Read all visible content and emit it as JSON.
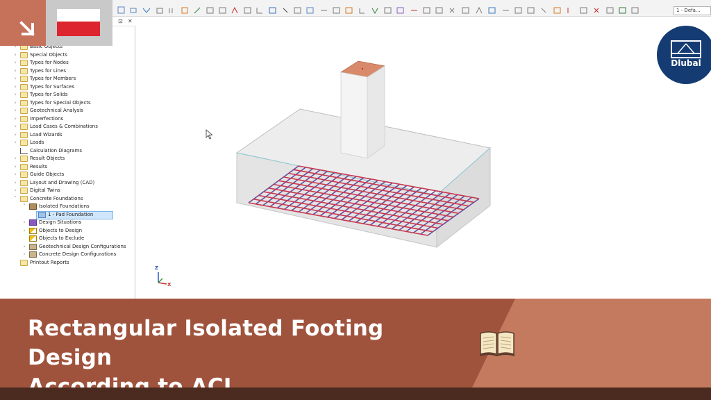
{
  "toolbar": {
    "view_selector": "1 - Defa..."
  },
  "navigator": {
    "items": [
      {
        "label": "Basic Objects",
        "icon": "folder-icon",
        "expandable": true,
        "indent": 0
      },
      {
        "label": "Special Objects",
        "icon": "folder-icon",
        "expandable": true,
        "indent": 0
      },
      {
        "label": "Types for Nodes",
        "icon": "folder-icon",
        "expandable": true,
        "indent": 0
      },
      {
        "label": "Types for Lines",
        "icon": "folder-icon",
        "expandable": true,
        "indent": 0
      },
      {
        "label": "Types for Members",
        "icon": "folder-icon",
        "expandable": true,
        "indent": 0
      },
      {
        "label": "Types for Surfaces",
        "icon": "folder-icon",
        "expandable": true,
        "indent": 0
      },
      {
        "label": "Types for Solids",
        "icon": "folder-icon",
        "expandable": true,
        "indent": 0
      },
      {
        "label": "Types for Special Objects",
        "icon": "folder-icon",
        "expandable": true,
        "indent": 0
      },
      {
        "label": "Geotechnical Analysis",
        "icon": "folder-icon",
        "expandable": true,
        "indent": 0
      },
      {
        "label": "Imperfections",
        "icon": "folder-icon",
        "expandable": true,
        "indent": 0
      },
      {
        "label": "Load Cases & Combinations",
        "icon": "folder-icon",
        "expandable": true,
        "indent": 0
      },
      {
        "label": "Load Wizards",
        "icon": "folder-icon",
        "expandable": true,
        "indent": 0
      },
      {
        "label": "Loads",
        "icon": "folder-icon",
        "expandable": true,
        "indent": 0
      },
      {
        "label": "Calculation Diagrams",
        "icon": "diagram-icon",
        "expandable": false,
        "indent": 0
      },
      {
        "label": "Result Objects",
        "icon": "folder-icon",
        "expandable": true,
        "indent": 0
      },
      {
        "label": "Results",
        "icon": "folder-icon",
        "expandable": true,
        "indent": 0
      },
      {
        "label": "Guide Objects",
        "icon": "folder-icon",
        "expandable": true,
        "indent": 0
      },
      {
        "label": "Layout and Drawing (CAD)",
        "icon": "folder-icon",
        "expandable": true,
        "indent": 0
      },
      {
        "label": "Digital Twins",
        "icon": "folder-icon",
        "expandable": true,
        "indent": 0
      },
      {
        "label": "Concrete Foundations",
        "icon": "folder-icon",
        "expandable": true,
        "expanded": true,
        "indent": 0
      },
      {
        "label": "Isolated Foundations",
        "icon": "foundation-icon",
        "expandable": true,
        "expanded": true,
        "indent": 1
      },
      {
        "label": "1 - Pad Foundation",
        "icon": "pad-icon",
        "expandable": false,
        "indent": 2,
        "selected": true
      },
      {
        "label": "Design Situations",
        "icon": "situation-icon",
        "expandable": true,
        "indent": 1
      },
      {
        "label": "Objects to Design",
        "icon": "design-object-icon",
        "expandable": true,
        "indent": 1
      },
      {
        "label": "Objects to Exclude",
        "icon": "exclude-object-icon",
        "expandable": false,
        "indent": 1
      },
      {
        "label": "Geotechnical Design Configurations",
        "icon": "config-icon",
        "expandable": true,
        "indent": 1
      },
      {
        "label": "Concrete Design Configurations",
        "icon": "config-icon",
        "expandable": true,
        "indent": 1
      },
      {
        "label": "Printout Reports",
        "icon": "folder-icon",
        "expandable": false,
        "indent": 0
      }
    ]
  },
  "axes": {
    "z": "Z",
    "x": "X"
  },
  "logo": {
    "text": "Dlubal"
  },
  "banner": {
    "title_line1": "Rectangular Isolated Footing Design",
    "title_line2": "According to ACI"
  },
  "colors": {
    "banner": "#a0533c",
    "banner_light": "#c47a5e",
    "footer": "#4b2a1f",
    "logo": "#153b73",
    "rebar": "#6a4b9c",
    "column_top": "#d98a6a"
  }
}
